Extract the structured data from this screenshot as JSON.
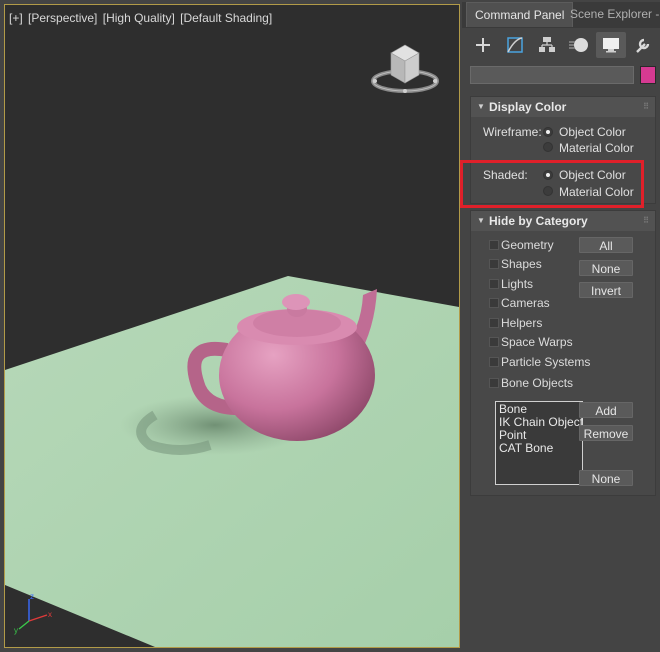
{
  "viewport": {
    "label_parts": [
      "[+]",
      "[Perspective]",
      "[High Quality]",
      "[Default Shading]"
    ],
    "teapot_color": "#c8739c",
    "ground_color": "#a9d1ac",
    "background_color": "#2e2e2e",
    "axis_labels": {
      "x": "x",
      "y": "y",
      "z": "z"
    }
  },
  "tabs": [
    {
      "label": "Command Panel",
      "active": true
    },
    {
      "label": "Scene Explorer - De",
      "active": false
    }
  ],
  "toolbar": {
    "icons": [
      "create-plus-icon",
      "modify-icon",
      "hierarchy-icon",
      "motion-icon",
      "display-icon",
      "utilities-wrench-icon"
    ],
    "active_index": 4
  },
  "object_color": "#d63a92",
  "display_color": {
    "title": "Display Color",
    "wireframe_label": "Wireframe:",
    "shaded_label": "Shaded:",
    "object_color_label": "Object Color",
    "material_color_label": "Material Color",
    "wireframe_selected": "Object Color",
    "shaded_selected": "Object Color"
  },
  "hide_by_category": {
    "title": "Hide by Category",
    "categories": [
      "Geometry",
      "Shapes",
      "Lights",
      "Cameras",
      "Helpers",
      "Space Warps",
      "Particle Systems",
      "Bone Objects"
    ],
    "buttons": {
      "all": "All",
      "none": "None",
      "invert": "Invert"
    },
    "list_items": [
      "Bone",
      "IK Chain Object",
      "Point",
      "CAT Bone"
    ],
    "add_label": "Add",
    "remove_label": "Remove",
    "none2_label": "None"
  }
}
